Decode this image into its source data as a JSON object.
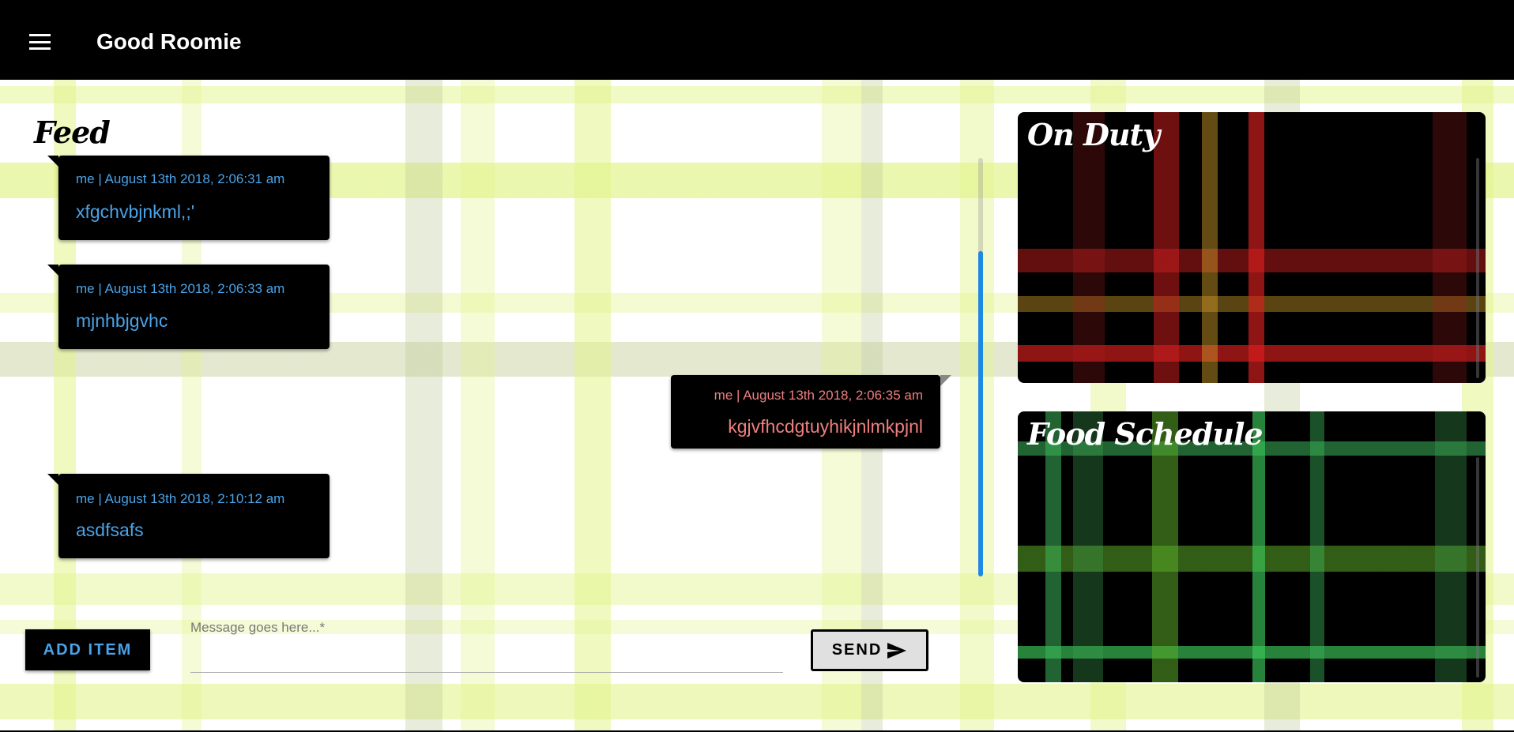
{
  "app": {
    "title": "Good Roomie"
  },
  "feed": {
    "title": "Feed",
    "messages": [
      {
        "meta": "me | August 13th 2018, 2:06:31 am",
        "body": "xfgchvbjnkml,;'",
        "side": "left"
      },
      {
        "meta": "me | August 13th 2018, 2:06:33 am",
        "body": "mjnhbjgvhc",
        "side": "left"
      },
      {
        "meta": "me | August 13th 2018, 2:06:35 am",
        "body": "kgjvfhcdgtuyhikjnlmkpjnl",
        "side": "right"
      },
      {
        "meta": "me | August 13th 2018, 2:10:12 am",
        "body": "asdfsafs",
        "side": "left"
      }
    ]
  },
  "composer": {
    "add_label": "ADD ITEM",
    "message_label": "Message goes here...*",
    "message_value": "",
    "send_label": "SEND",
    "send_icon": "send-arrow-icon"
  },
  "panels": {
    "on_duty": {
      "title": "On Duty"
    },
    "food_schedule": {
      "title": "Food Schedule"
    }
  },
  "colors": {
    "appbar": "#000000",
    "left_message_text": "#4aa3e8",
    "right_message_text": "#f07f7f",
    "scroll_accent": "#1e88e5"
  }
}
